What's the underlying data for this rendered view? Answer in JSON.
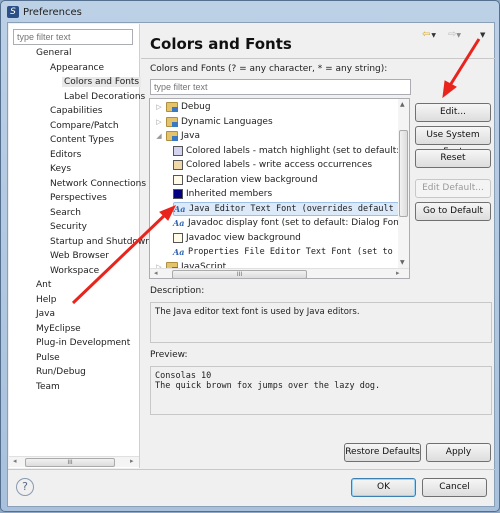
{
  "window": {
    "title": "Preferences"
  },
  "left": {
    "filter_placeholder": "type filter text",
    "tree": [
      {
        "label": "General",
        "level": 0
      },
      {
        "label": "Appearance",
        "level": 1
      },
      {
        "label": "Colors and Fonts",
        "level": 2,
        "selected": true
      },
      {
        "label": "Label Decorations",
        "level": 2
      },
      {
        "label": "Capabilities",
        "level": 1
      },
      {
        "label": "Compare/Patch",
        "level": 1
      },
      {
        "label": "Content Types",
        "level": 1
      },
      {
        "label": "Editors",
        "level": 1
      },
      {
        "label": "Keys",
        "level": 1
      },
      {
        "label": "Network Connections",
        "level": 1
      },
      {
        "label": "Perspectives",
        "level": 1
      },
      {
        "label": "Search",
        "level": 1
      },
      {
        "label": "Security",
        "level": 1
      },
      {
        "label": "Startup and Shutdown",
        "level": 1
      },
      {
        "label": "Web Browser",
        "level": 1
      },
      {
        "label": "Workspace",
        "level": 1
      },
      {
        "label": "Ant",
        "level": 0
      },
      {
        "label": "Help",
        "level": 0
      },
      {
        "label": "Java",
        "level": 0
      },
      {
        "label": "MyEclipse",
        "level": 0
      },
      {
        "label": "Plug-in Development",
        "level": 0
      },
      {
        "label": "Pulse",
        "level": 0
      },
      {
        "label": "Run/Debug",
        "level": 0
      },
      {
        "label": "Team",
        "level": 0
      }
    ]
  },
  "page": {
    "title": "Colors and Fonts",
    "filter_label": "Colors and Fonts (? = any character, * = any string):",
    "filter_placeholder": "type filter text",
    "tree": [
      {
        "label": "Debug",
        "kind": "folder",
        "twisty": "▷"
      },
      {
        "label": "Dynamic Languages",
        "kind": "folder",
        "twisty": "▷"
      },
      {
        "label": "Java",
        "kind": "folder",
        "twisty": "◢"
      },
      {
        "label": "Colored labels - match highlight (set to default: ",
        "kind": "color",
        "color": "#d4d4f0"
      },
      {
        "label": "Colored labels - write access occurrences",
        "kind": "color",
        "color": "#f0d8a8"
      },
      {
        "label": "Declaration view background",
        "kind": "color",
        "color": "#fffbe6"
      },
      {
        "label": "Inherited members",
        "kind": "color",
        "color": "#000080"
      },
      {
        "label": "Java Editor Text Font (overrides default",
        "kind": "font",
        "selected": true
      },
      {
        "label": "Javadoc display font (set to default: Dialog Font",
        "kind": "font"
      },
      {
        "label": "Javadoc view background",
        "kind": "color",
        "color": "#fffbe6"
      },
      {
        "label": "Properties File Editor Text Font (set to",
        "kind": "font",
        "mono": true
      },
      {
        "label": "JavaScript",
        "kind": "folder",
        "twisty": "▷"
      }
    ],
    "buttons": {
      "edit": "Edit...",
      "use_system_font": "Use System Font",
      "reset": "Reset",
      "edit_default": "Edit Default...",
      "go_to_default": "Go to Default"
    },
    "description_label": "Description:",
    "description": "The Java editor text font is used by Java editors.",
    "preview_label": "Preview:",
    "preview_line1": "Consolas 10",
    "preview_line2": "The quick brown fox jumps over the lazy dog.",
    "restore_defaults": "Restore Defaults",
    "apply": "Apply"
  },
  "footer": {
    "ok": "OK",
    "cancel": "Cancel"
  },
  "colors": {
    "annotation_arrow": "#e8241c",
    "selection": "#dbe9f9"
  }
}
